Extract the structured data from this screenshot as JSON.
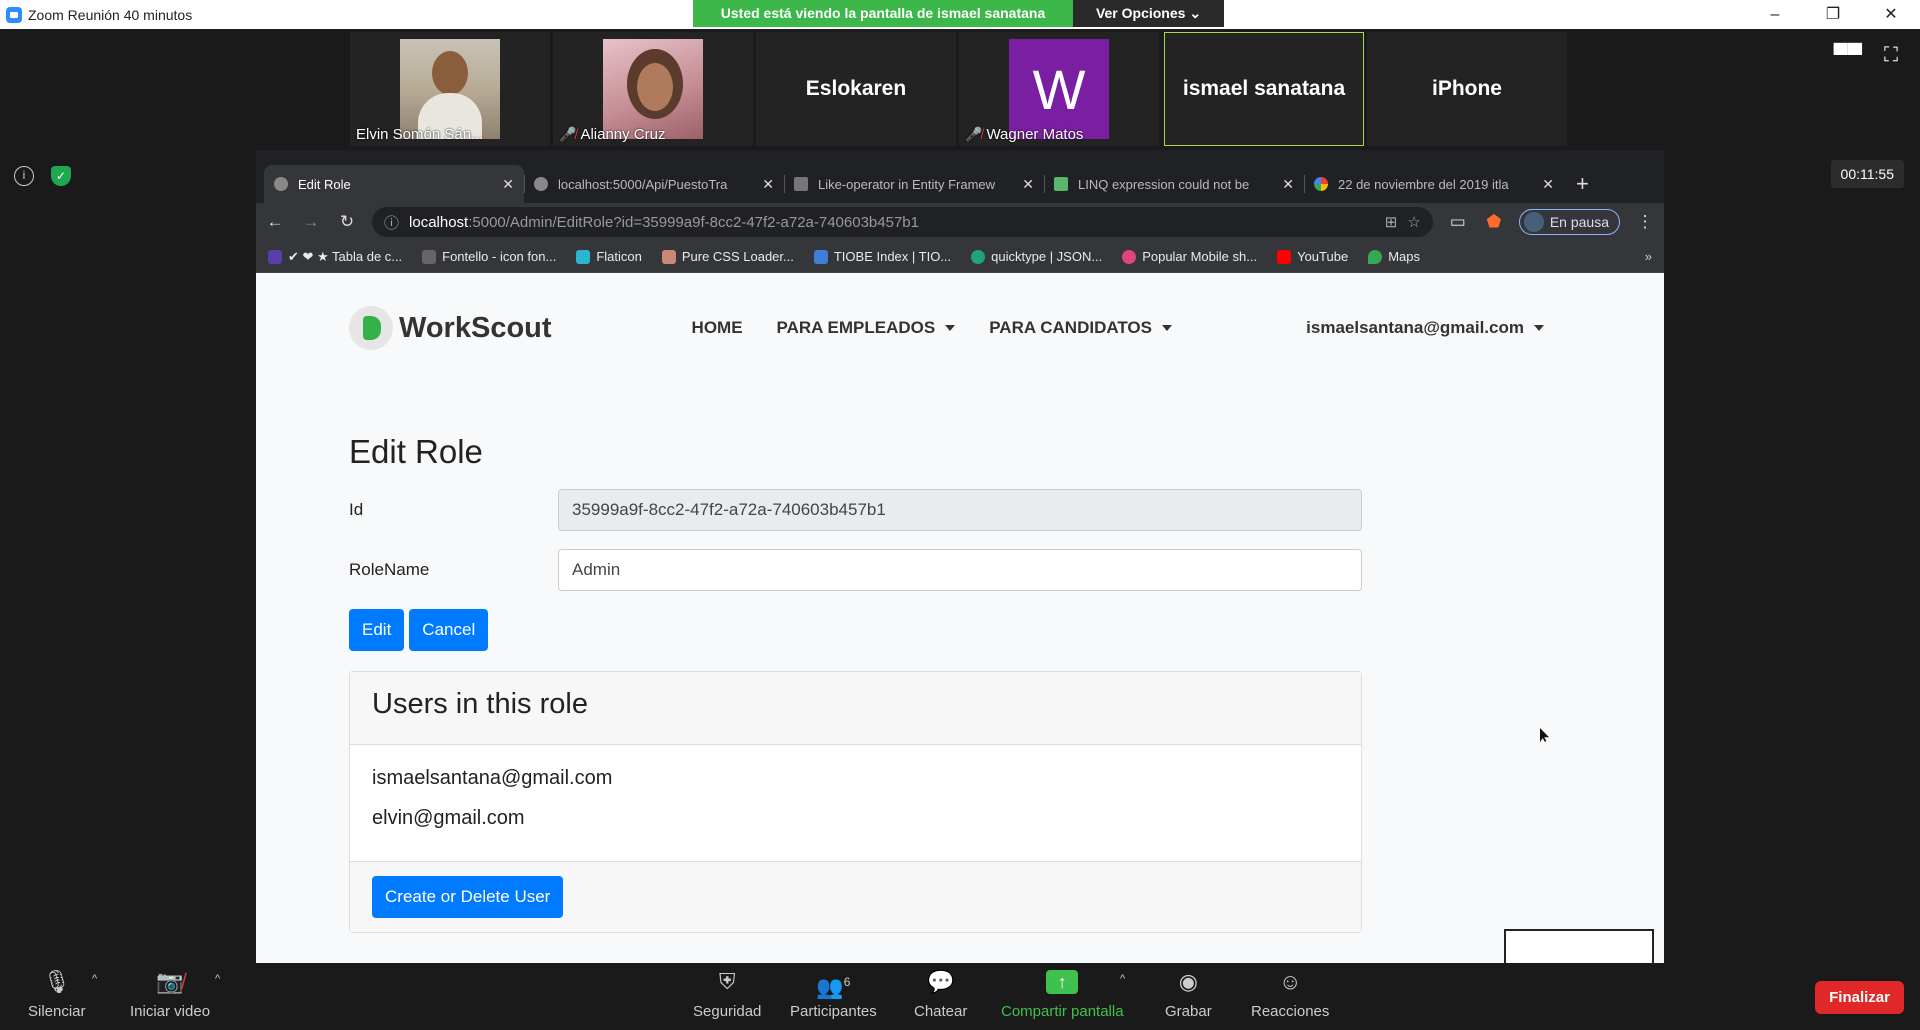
{
  "window": {
    "title": "Zoom Reunión 40 minutos",
    "share_banner": "Usted está viendo la pantalla de ismael sanatana",
    "view_options": "Ver Opciones",
    "timer": "00:11:55"
  },
  "participants": [
    {
      "name": "Elvin Somón Sán..."
    },
    {
      "name": "Alianny Cruz"
    },
    {
      "name": "Eslokaren"
    },
    {
      "name": "Wagner Matos",
      "initial": "W"
    },
    {
      "name": "ismael sanatana"
    },
    {
      "name": "iPhone"
    }
  ],
  "browser": {
    "tabs": [
      {
        "label": "Edit Role"
      },
      {
        "label": "localhost:5000/Api/PuestoTra"
      },
      {
        "label": "Like-operator in Entity Framew"
      },
      {
        "label": "LINQ expression could not be"
      },
      {
        "label": "22 de noviembre del 2019 itla"
      }
    ],
    "url_host": "localhost",
    "url_path": ":5000/Admin/EditRole?id=35999a9f-8cc2-47f2-a72a-740603b457b1",
    "profile_label": "En pausa",
    "bookmarks": [
      {
        "label": "✔ ❤ ★ Tabla de c...",
        "color": "#5b3fa8"
      },
      {
        "label": "Fontello - icon fon...",
        "color": "#666666"
      },
      {
        "label": "Flaticon",
        "color": "#2ab5d0"
      },
      {
        "label": "Pure CSS Loader...",
        "color": "#cc8877"
      },
      {
        "label": "TIOBE Index | TIO...",
        "color": "#3d7fd6"
      },
      {
        "label": "quicktype | JSON...",
        "color": "#1ea37a"
      },
      {
        "label": "Popular Mobile sh...",
        "color": "#e0457b"
      },
      {
        "label": "YouTube",
        "color": "#ff0000"
      },
      {
        "label": "Maps",
        "color": "#34a853"
      }
    ]
  },
  "site": {
    "brand": "WorkScout",
    "menu": {
      "home": "HOME",
      "employers": "PARA EMPLEADOS",
      "candidates": "PARA CANDIDATOS"
    },
    "user_email": "ismaelsantana@gmail.com"
  },
  "form": {
    "heading": "Edit Role",
    "id_label": "Id",
    "id_value": "35999a9f-8cc2-47f2-a72a-740603b457b1",
    "rolename_label": "RoleName",
    "rolename_value": "Admin",
    "edit_button": "Edit",
    "cancel_button": "Cancel"
  },
  "users_card": {
    "title": "Users in this role",
    "users": [
      "ismaelsantana@gmail.com",
      "elvin@gmail.com"
    ],
    "action_button": "Create or Delete User"
  },
  "controls": {
    "mute": "Silenciar",
    "start_video": "Iniciar video",
    "security": "Seguridad",
    "participants": "Participantes",
    "participants_count": "6",
    "chat": "Chatear",
    "share_screen": "Compartir pantalla",
    "record": "Grabar",
    "reactions": "Reacciones",
    "end": "Finalizar"
  }
}
